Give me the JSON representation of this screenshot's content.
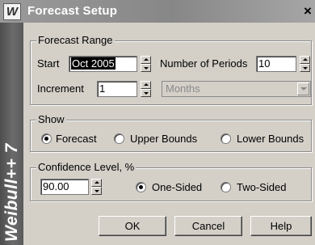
{
  "window": {
    "title": "Forecast Setup",
    "close_glyph": "×",
    "logo_glyph": "W"
  },
  "sidebar": {
    "label": "Weibull++ 7"
  },
  "forecast_range": {
    "legend": "Forecast Range",
    "start_label": "Start",
    "start_value": "Oct 2005",
    "periods_label": "Number of Periods",
    "periods_value": "10",
    "increment_label": "Increment",
    "increment_value": "1",
    "unit_value": "Months"
  },
  "show": {
    "legend": "Show",
    "options": [
      {
        "label": "Forecast",
        "checked": true
      },
      {
        "label": "Upper Bounds",
        "checked": false
      },
      {
        "label": "Lower Bounds",
        "checked": false
      }
    ]
  },
  "confidence": {
    "legend": "Confidence Level, %",
    "value": "90.00",
    "options": [
      {
        "label": "One-Sided",
        "checked": true
      },
      {
        "label": "Two-Sided",
        "checked": false
      }
    ]
  },
  "buttons": {
    "ok": "OK",
    "cancel": "Cancel",
    "help": "Help"
  }
}
